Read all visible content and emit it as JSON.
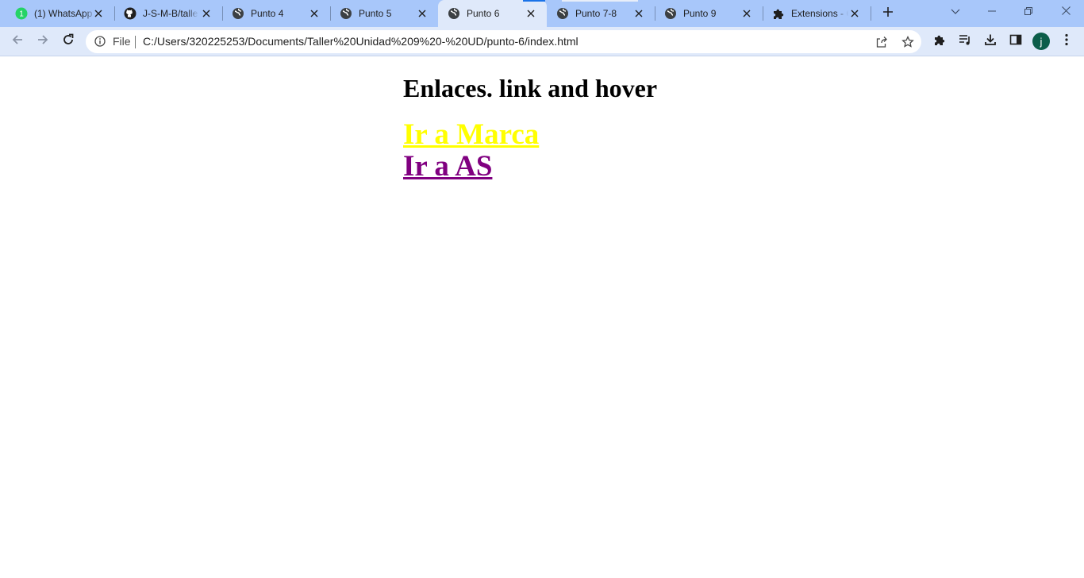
{
  "browser": {
    "tabs": [
      {
        "title": "(1) WhatsApp",
        "icon": "whatsapp-icon",
        "active": false
      },
      {
        "title": "J-S-M-B/taller",
        "icon": "github-icon",
        "active": false
      },
      {
        "title": "Punto 4",
        "icon": "globe-icon",
        "active": false
      },
      {
        "title": "Punto 5",
        "icon": "globe-icon",
        "active": false
      },
      {
        "title": "Punto 6",
        "icon": "globe-icon",
        "active": true
      },
      {
        "title": "Punto 7-8",
        "icon": "globe-icon",
        "active": false
      },
      {
        "title": "Punto 9",
        "icon": "globe-icon",
        "active": false
      },
      {
        "title": "Extensions - Chrome",
        "icon": "puzzle-icon",
        "active": false
      }
    ],
    "whatsapp_badge": "1",
    "address_bar": {
      "scheme_label": "File",
      "url": "C:/Users/320225253/Documents/Taller%20Unidad%209%20-%20UD/punto-6/index.html"
    },
    "profile_initial": "j",
    "colors": {
      "tabstrip_bg": "#a8c7fa",
      "toolbar_bg": "#dfe9fa",
      "avatar_bg": "#0b5d4a"
    }
  },
  "page": {
    "heading": "Enlaces. link and hover",
    "links": [
      {
        "label": "Ir a Marca",
        "color": "#ffff00"
      },
      {
        "label": "Ir a AS",
        "color": "#800080"
      }
    ]
  }
}
